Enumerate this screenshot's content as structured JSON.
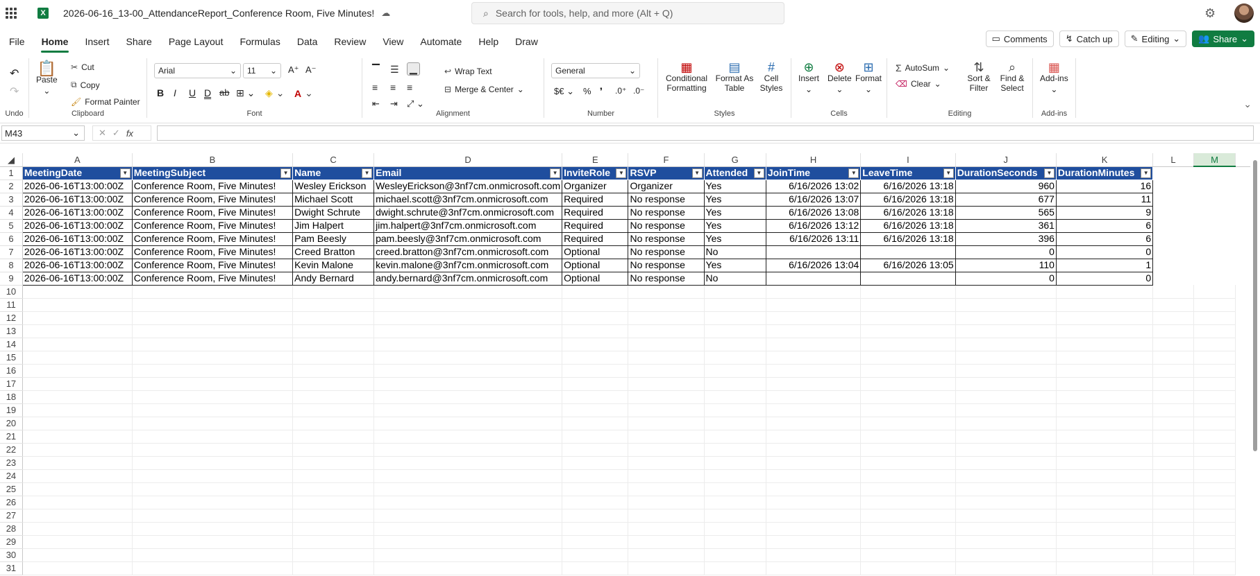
{
  "app": {
    "title": "2026-06-16_13-00_AttendanceReport_Conference Room, Five Minutes!",
    "search_placeholder": "Search for tools, help, and more (Alt + Q)"
  },
  "tabs": [
    "File",
    "Home",
    "Insert",
    "Share",
    "Page Layout",
    "Formulas",
    "Data",
    "Review",
    "View",
    "Automate",
    "Help",
    "Draw"
  ],
  "active_tab": "Home",
  "top_right": {
    "comments": "Comments",
    "catchup": "Catch up",
    "editing": "Editing",
    "share": "Share"
  },
  "ribbon": {
    "undo_label": "Undo",
    "clipboard": {
      "label": "Clipboard",
      "paste": "Paste",
      "cut": "Cut",
      "copy": "Copy",
      "format_painter": "Format Painter"
    },
    "font": {
      "label": "Font",
      "name": "Arial",
      "size": "11"
    },
    "alignment": {
      "label": "Alignment",
      "wrap": "Wrap Text",
      "merge": "Merge & Center"
    },
    "number": {
      "label": "Number",
      "format": "General"
    },
    "styles": {
      "label": "Styles",
      "conditional": "Conditional Formatting",
      "format_table": "Format As Table",
      "cell_styles": "Cell Styles"
    },
    "cells": {
      "label": "Cells",
      "insert": "Insert",
      "delete": "Delete",
      "format": "Format"
    },
    "editing": {
      "label": "Editing",
      "autosum": "AutoSum",
      "clear": "Clear",
      "sort": "Sort & Filter",
      "find": "Find & Select"
    },
    "addins": {
      "label": "Add-ins",
      "addins": "Add-ins"
    }
  },
  "formula_bar": {
    "name_box": "M43",
    "fx": "fx",
    "value": ""
  },
  "sheet": {
    "columns": [
      "A",
      "B",
      "C",
      "D",
      "E",
      "F",
      "G",
      "H",
      "I",
      "J",
      "K",
      "L",
      "M"
    ],
    "selected_column": "M",
    "headers": [
      "MeetingDate",
      "MeetingSubject",
      "Name",
      "Email",
      "InviteRole",
      "RSVP",
      "Attended",
      "JoinTime",
      "LeaveTime",
      "DurationSeconds",
      "DurationMinutes"
    ],
    "rows": [
      [
        "2026-06-16T13:00:00Z",
        "Conference Room, Five Minutes!",
        "Wesley Erickson",
        "WesleyErickson@3nf7cm.onmicrosoft.com",
        "Organizer",
        "Organizer",
        "Yes",
        "6/16/2026 13:02",
        "6/16/2026 13:18",
        "960",
        "16"
      ],
      [
        "2026-06-16T13:00:00Z",
        "Conference Room, Five Minutes!",
        "Michael Scott",
        "michael.scott@3nf7cm.onmicrosoft.com",
        "Required",
        "No response",
        "Yes",
        "6/16/2026 13:07",
        "6/16/2026 13:18",
        "677",
        "11"
      ],
      [
        "2026-06-16T13:00:00Z",
        "Conference Room, Five Minutes!",
        "Dwight Schrute",
        "dwight.schrute@3nf7cm.onmicrosoft.com",
        "Required",
        "No response",
        "Yes",
        "6/16/2026 13:08",
        "6/16/2026 13:18",
        "565",
        "9"
      ],
      [
        "2026-06-16T13:00:00Z",
        "Conference Room, Five Minutes!",
        "Jim Halpert",
        "jim.halpert@3nf7cm.onmicrosoft.com",
        "Required",
        "No response",
        "Yes",
        "6/16/2026 13:12",
        "6/16/2026 13:18",
        "361",
        "6"
      ],
      [
        "2026-06-16T13:00:00Z",
        "Conference Room, Five Minutes!",
        "Pam Beesly",
        "pam.beesly@3nf7cm.onmicrosoft.com",
        "Required",
        "No response",
        "Yes",
        "6/16/2026 13:11",
        "6/16/2026 13:18",
        "396",
        "6"
      ],
      [
        "2026-06-16T13:00:00Z",
        "Conference Room, Five Minutes!",
        "Creed Bratton",
        "creed.bratton@3nf7cm.onmicrosoft.com",
        "Optional",
        "No response",
        "No",
        "",
        "",
        "0",
        "0"
      ],
      [
        "2026-06-16T13:00:00Z",
        "Conference Room, Five Minutes!",
        "Kevin Malone",
        "kevin.malone@3nf7cm.onmicrosoft.com",
        "Optional",
        "No response",
        "Yes",
        "6/16/2026 13:04",
        "6/16/2026 13:05",
        "110",
        "1"
      ],
      [
        "2026-06-16T13:00:00Z",
        "Conference Room, Five Minutes!",
        "Andy Bernard",
        "andy.bernard@3nf7cm.onmicrosoft.com",
        "Optional",
        "No response",
        "No",
        "",
        "",
        "0",
        "0"
      ]
    ],
    "row_numbers": [
      "1",
      "2",
      "3",
      "4",
      "5",
      "6",
      "7",
      "8",
      "9",
      "10",
      "11",
      "12",
      "13",
      "14",
      "15",
      "16",
      "17",
      "18",
      "19",
      "20",
      "21",
      "22",
      "23",
      "24",
      "25",
      "26",
      "27",
      "28",
      "29",
      "30",
      "31"
    ]
  },
  "colors": {
    "accent": "#107c41",
    "table_header": "#1f4e9e"
  }
}
